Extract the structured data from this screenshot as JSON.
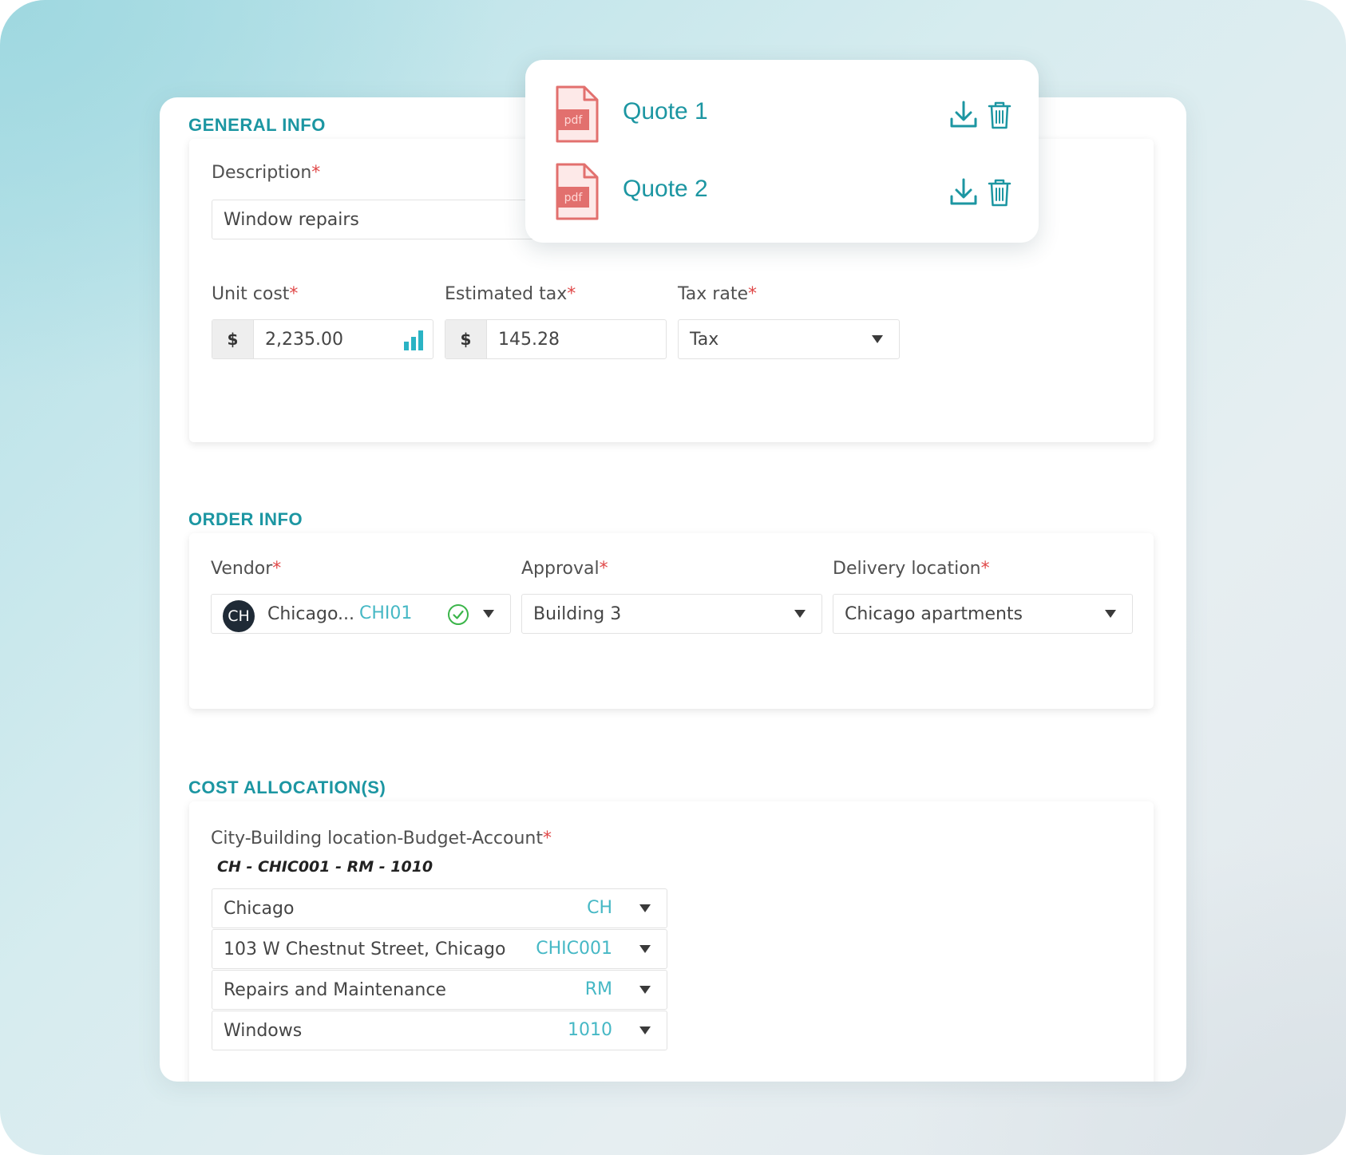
{
  "colors": {
    "accent": "#1c96a2",
    "code": "#46b8c5",
    "required": "#e04848",
    "check": "#3bb54a",
    "pdf": "#e2706e"
  },
  "general_info": {
    "title": "GENERAL INFO",
    "description": {
      "label": "Description",
      "required": "*",
      "value": "Window repairs"
    },
    "unit_cost": {
      "label": "Unit cost",
      "required": "*",
      "prefix": "$",
      "value": "2,235.00",
      "icon": "bar-chart-icon"
    },
    "estimated_tax": {
      "label": "Estimated tax",
      "required": "*",
      "prefix": "$",
      "value": "145.28"
    },
    "tax_rate": {
      "label": "Tax rate",
      "required": "*",
      "value": "Tax"
    }
  },
  "attachments": [
    {
      "name": "Quote 1",
      "icon": "pdf-icon",
      "icon_text": "pdf"
    },
    {
      "name": "Quote 2",
      "icon": "pdf-icon",
      "icon_text": "pdf"
    }
  ],
  "order_info": {
    "title": "ORDER INFO",
    "vendor": {
      "label": "Vendor",
      "required": "*",
      "avatar": "CH",
      "value": "Chicago...",
      "code": "CHI01",
      "status_icon": "check-circle-icon"
    },
    "approval": {
      "label": "Approval",
      "required": "*",
      "value": "Building 3"
    },
    "delivery": {
      "label": "Delivery location",
      "required": "*",
      "value": "Chicago apartments"
    }
  },
  "cost_allocation": {
    "title": "COST ALLOCATION(S)",
    "label": "City-Building location-Budget-Account",
    "required": "*",
    "path": "CH - CHIC001 - RM - 1010",
    "rows": [
      {
        "value": "Chicago",
        "code": "CH"
      },
      {
        "value": "103 W Chestnut Street, Chicago",
        "code": "CHIC001"
      },
      {
        "value": "Repairs and Maintenance",
        "code": "RM"
      },
      {
        "value": "Windows",
        "code": "1010"
      }
    ]
  }
}
